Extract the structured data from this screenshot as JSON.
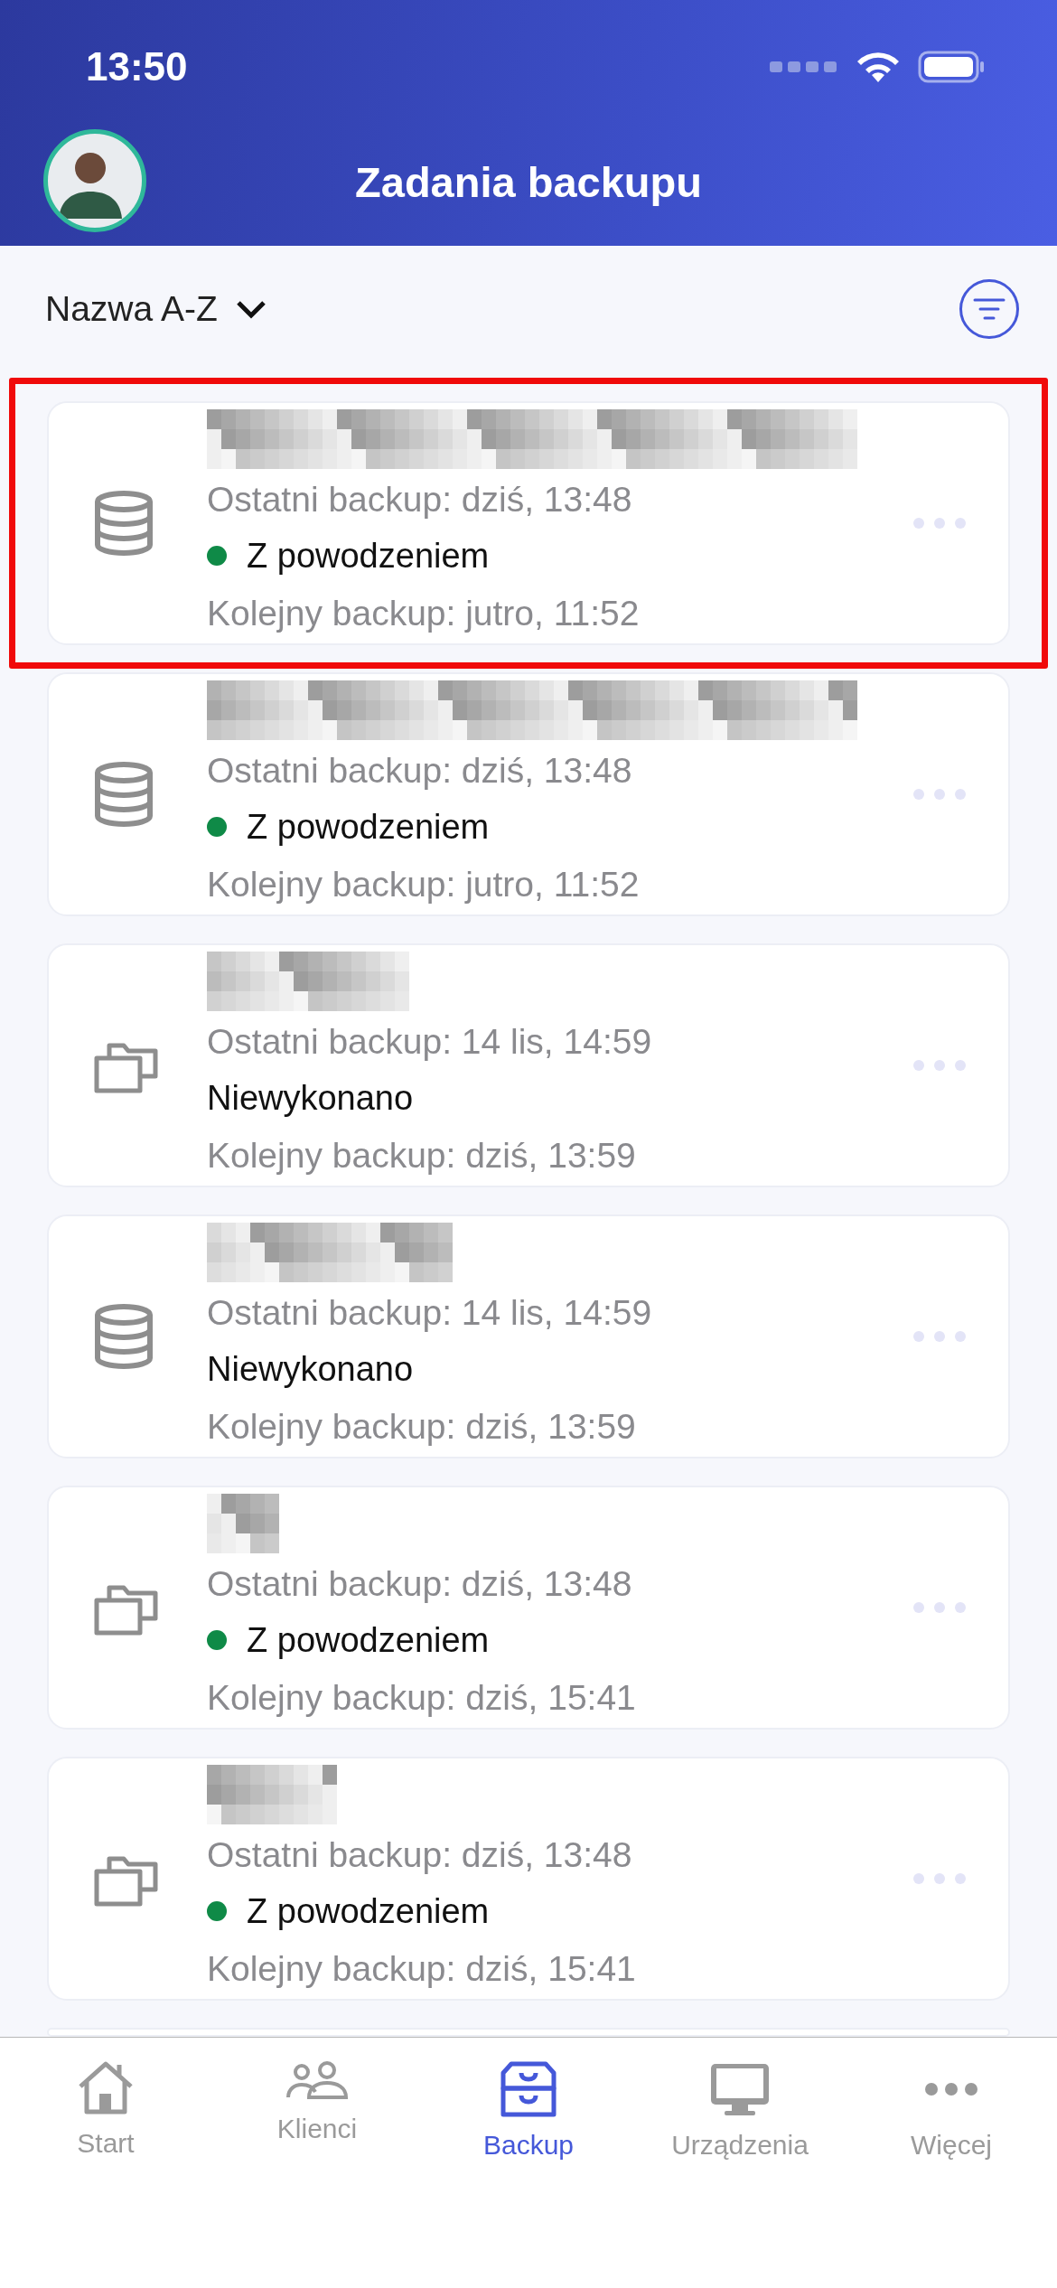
{
  "status_bar": {
    "time": "13:50"
  },
  "header": {
    "title": "Zadania backupu"
  },
  "sort": {
    "label": "Nazwa A-Z"
  },
  "jobs": [
    {
      "kind": "database",
      "highlighted": true,
      "last": "Ostatni backup: dziś, 13:48",
      "status": {
        "kind": "success",
        "text": "Z powodzeniem",
        "color": "#0f8a47"
      },
      "next": "Kolejny backup: jutro, 11:52"
    },
    {
      "kind": "database",
      "highlighted": false,
      "last": "Ostatni backup: dziś, 13:48",
      "status": {
        "kind": "success",
        "text": "Z powodzeniem",
        "color": "#0f8a47"
      },
      "next": "Kolejny backup: jutro, 11:52"
    },
    {
      "kind": "files",
      "highlighted": false,
      "last": "Ostatni backup: 14 lis, 14:59",
      "status": {
        "kind": "not_run",
        "text": "Niewykonano"
      },
      "next": "Kolejny backup: dziś, 13:59"
    },
    {
      "kind": "database",
      "highlighted": false,
      "last": "Ostatni backup: 14 lis, 14:59",
      "status": {
        "kind": "not_run",
        "text": "Niewykonano"
      },
      "next": "Kolejny backup: dziś, 13:59"
    },
    {
      "kind": "files",
      "highlighted": false,
      "last": "Ostatni backup: dziś, 13:48",
      "status": {
        "kind": "success",
        "text": "Z powodzeniem",
        "color": "#0f8a47"
      },
      "next": "Kolejny backup: dziś, 15:41"
    },
    {
      "kind": "files",
      "highlighted": false,
      "last": "Ostatni backup: dziś, 13:48",
      "status": {
        "kind": "success",
        "text": "Z powodzeniem",
        "color": "#0f8a47"
      },
      "next": "Kolejny backup: dziś, 15:41"
    }
  ],
  "more_below": true,
  "tabs": [
    {
      "kind": "home",
      "label": "Start",
      "selected": false
    },
    {
      "kind": "clients",
      "label": "Klienci",
      "selected": false
    },
    {
      "kind": "backup",
      "label": "Backup",
      "selected": true
    },
    {
      "kind": "devices",
      "label": "Urządzenia",
      "selected": false
    },
    {
      "kind": "more",
      "label": "Więcej",
      "selected": false
    }
  ]
}
